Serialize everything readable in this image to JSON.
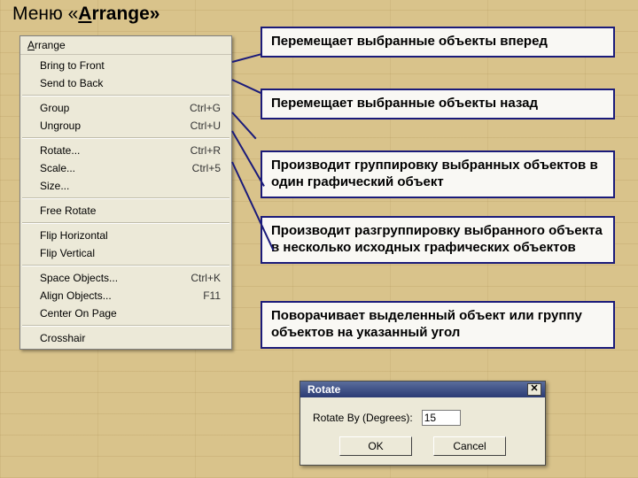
{
  "page_title": {
    "prefix": "Меню «",
    "underlined": "A",
    "rest": "rrange»"
  },
  "menu": {
    "header": {
      "underlined": "A",
      "rest": "rrange"
    },
    "items": [
      {
        "label": "Bring to Front",
        "shortcut": ""
      },
      {
        "label": "Send to Back",
        "shortcut": ""
      },
      {
        "sep": true
      },
      {
        "label": "Group",
        "shortcut": "Ctrl+G"
      },
      {
        "label": "Ungroup",
        "shortcut": "Ctrl+U"
      },
      {
        "sep": true
      },
      {
        "label": "Rotate...",
        "shortcut": "Ctrl+R"
      },
      {
        "label": "Scale...",
        "shortcut": "Ctrl+5"
      },
      {
        "label": "Size...",
        "shortcut": ""
      },
      {
        "sep": true
      },
      {
        "label": "Free Rotate",
        "shortcut": ""
      },
      {
        "sep": true
      },
      {
        "label": "Flip Horizontal",
        "shortcut": ""
      },
      {
        "label": "Flip Vertical",
        "shortcut": ""
      },
      {
        "sep": true
      },
      {
        "label": "Space Objects...",
        "shortcut": "Ctrl+K"
      },
      {
        "label": "Align Objects...",
        "shortcut": "F11"
      },
      {
        "label": "Center On Page",
        "shortcut": ""
      },
      {
        "sep": true
      },
      {
        "label": "Crosshair",
        "shortcut": ""
      }
    ]
  },
  "callouts": {
    "c1": "Перемещает выбранные объекты вперед",
    "c2": "Перемещает выбранные объекты назад",
    "c3": "Производит группировку выбранных объектов в один графический объект",
    "c4": "Производит разгруппировку выбранного объекта в несколько исходных графических объектов",
    "c5": "Поворачивает выделенный объект или группу объектов на указанный угол"
  },
  "dialog": {
    "title": "Rotate",
    "label": "Rotate By (Degrees):",
    "value": "15",
    "ok": "OK",
    "cancel": "Cancel"
  }
}
